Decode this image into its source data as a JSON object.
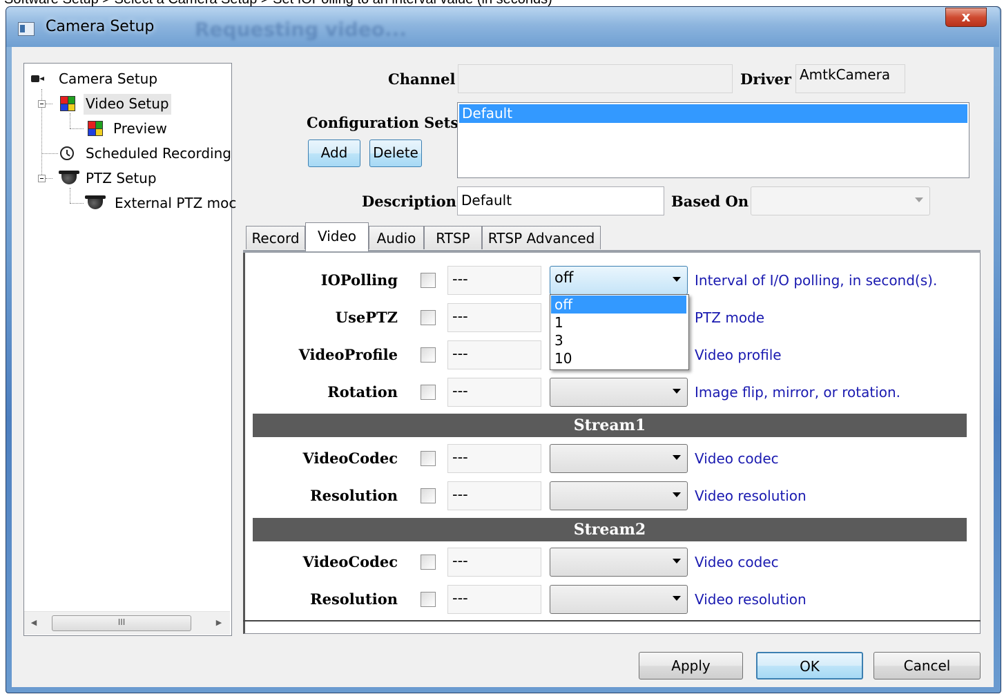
{
  "caption": "Software Setup > Select a Camera Setup > Set IOPolling to an interval value (in seconds)",
  "window": {
    "title": "Camera Setup",
    "ghost_title": "Requesting video...",
    "close_label": "x"
  },
  "tree": {
    "items": [
      {
        "label": "Camera Setup"
      },
      {
        "label": "Video Setup"
      },
      {
        "label": "Preview"
      },
      {
        "label": "Scheduled Recording"
      },
      {
        "label": "PTZ Setup"
      },
      {
        "label": "External PTZ moc"
      }
    ],
    "scroll_thumb": "III"
  },
  "header": {
    "channel_label": "Channel",
    "channel_value": "",
    "driver_label": "Driver",
    "driver_value": "AmtkCamera",
    "config_sets_label": "Configuration Sets",
    "add_label": "Add",
    "delete_label": "Delete",
    "config_sets": [
      "Default"
    ],
    "description_label": "Description",
    "description_value": "Default",
    "based_on_label": "Based On",
    "based_on_value": ""
  },
  "tabs": [
    {
      "label": "Record"
    },
    {
      "label": "Video",
      "active": true
    },
    {
      "label": "Audio"
    },
    {
      "label": "RTSP"
    },
    {
      "label": "RTSP Advanced"
    }
  ],
  "video": {
    "rows": [
      {
        "label": "IOPolling",
        "dash": "---",
        "value": "off",
        "desc": "Interval of I/O polling, in second(s)."
      },
      {
        "label": "UsePTZ",
        "dash": "---",
        "value": "",
        "desc": "PTZ mode"
      },
      {
        "label": "VideoProfile",
        "dash": "---",
        "value": "",
        "desc": "Video profile"
      },
      {
        "label": "Rotation",
        "dash": "---",
        "value": "",
        "desc": "Image flip, mirror, or rotation."
      }
    ],
    "stream1": {
      "title": "Stream1",
      "rows": [
        {
          "label": "VideoCodec",
          "dash": "---",
          "value": "",
          "desc": "Video codec"
        },
        {
          "label": "Resolution",
          "dash": "---",
          "value": "",
          "desc": "Video resolution"
        }
      ]
    },
    "stream2": {
      "title": "Stream2",
      "rows": [
        {
          "label": "VideoCodec",
          "dash": "---",
          "value": "",
          "desc": "Video codec"
        },
        {
          "label": "Resolution",
          "dash": "---",
          "value": "",
          "desc": "Video resolution"
        }
      ]
    },
    "iopolling_options": [
      "off",
      "1",
      "3",
      "10"
    ]
  },
  "footer": {
    "apply_label": "Apply",
    "ok_label": "OK",
    "cancel_label": "Cancel"
  },
  "colors": {
    "selection": "#3399ff",
    "description_text": "#1a1ab0",
    "section_header": "#5b5b5b"
  }
}
